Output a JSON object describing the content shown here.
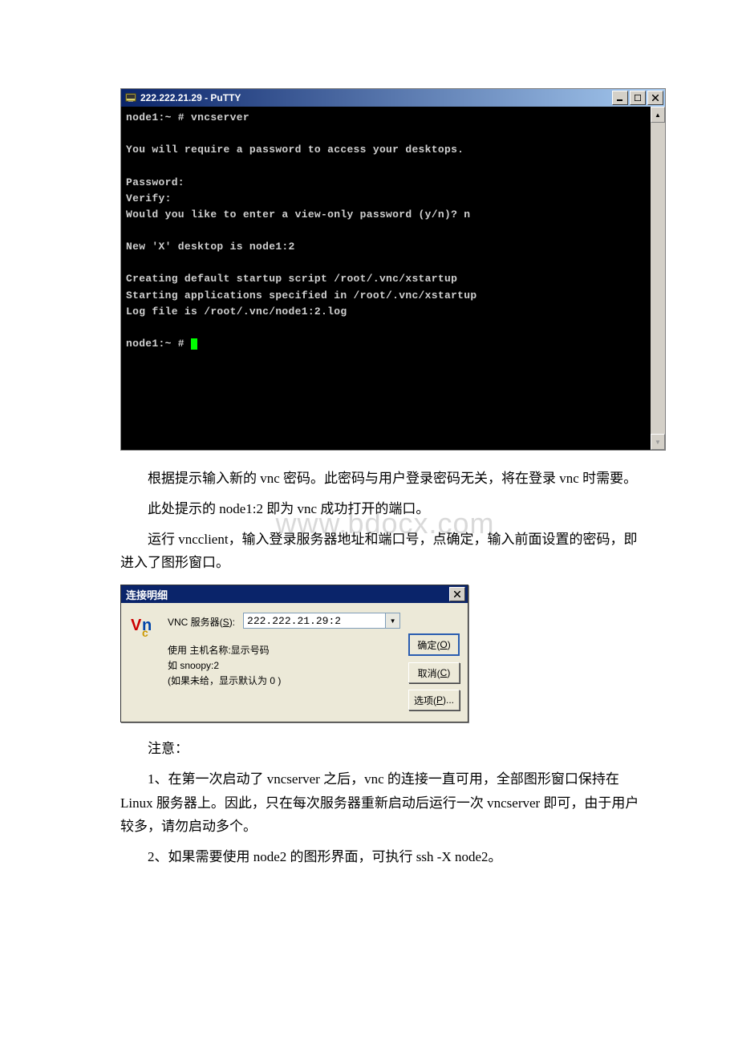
{
  "putty": {
    "title": "222.222.21.29 - PuTTY",
    "terminal_lines": "node1:~ # vncserver\n\nYou will require a password to access your desktops.\n\nPassword:\nVerify:\nWould you like to enter a view-only password (y/n)? n\n\nNew 'X' desktop is node1:2\n\nCreating default startup script /root/.vnc/xstartup\nStarting applications specified in /root/.vnc/xstartup\nLog file is /root/.vnc/node1:2.log\n\nnode1:~ # "
  },
  "paragraphs": {
    "p1a": "根据提示输入新的 ",
    "p1b": "vnc",
    "p1c": " 密码。此密码与用户登录密码无关，将在登录 ",
    "p1d": "vnc",
    "p1e": " 时需要。",
    "p2a": "此处提示的 ",
    "p2b": "node1:2",
    "p2c": " 即为 ",
    "p2d": "vnc",
    "p2e": " 成功打开的端口。",
    "p3a": "运行 ",
    "p3b": "vncclient",
    "p3c": "，输入登录服务器地址和端口号，点确定，输入前面设置的密码，即进入了图形窗口。",
    "p4": "注意：",
    "p5a": "1",
    "p5b": "、在第一次启动了 ",
    "p5c": "vncserver",
    "p5d": " 之后，",
    "p5e": "vnc",
    "p5f": " 的连接一直可用，全部图形窗口保持在 ",
    "p5g": "Linux",
    "p5h": " 服务器上。因此，只在每次服务器重新启动后运行一次 ",
    "p5i": "vncserver",
    "p5j": " 即可，由于用户较多，请勿启动多个。",
    "p6a": "2",
    "p6b": "、如果需要使用 ",
    "p6c": "node2",
    "p6d": " 的图形界面，可执行 ",
    "p6e": "ssh -X node2",
    "p6f": "。"
  },
  "watermark": "www.bdocx.com",
  "vnc_dialog": {
    "title": "连接明细",
    "server_label_pre": "VNC 服务器(",
    "server_label_u": "S",
    "server_label_post": "):",
    "server_value": "222.222.21.29:2",
    "hint": "使用 主机名称:显示号码\n如 snoopy:2\n(如果未给，显示默认为 0 )",
    "btn_ok_pre": "确定(",
    "btn_ok_u": "O",
    "btn_ok_post": ")",
    "btn_cancel_pre": "取消(",
    "btn_cancel_u": "C",
    "btn_cancel_post": ")",
    "btn_opt_pre": "选项(",
    "btn_opt_u": "P",
    "btn_opt_post": ")..."
  }
}
